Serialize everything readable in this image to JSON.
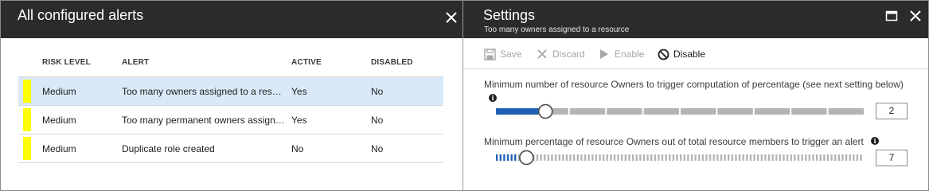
{
  "left_blade": {
    "title": "All configured alerts",
    "columns": [
      "RISK LEVEL",
      "ALERT",
      "ACTIVE",
      "DISABLED"
    ],
    "rows": [
      {
        "risk": "Medium",
        "alert": "Too many owners assigned to a resource",
        "active": "Yes",
        "disabled": "No",
        "selected": true
      },
      {
        "risk": "Medium",
        "alert": "Too many permanent owners assigned",
        "active": "Yes",
        "disabled": "No",
        "selected": false
      },
      {
        "risk": "Medium",
        "alert": "Duplicate role created",
        "active": "No",
        "disabled": "No",
        "selected": false
      }
    ],
    "severity_color": "#ffff00"
  },
  "right_blade": {
    "title": "Settings",
    "subtitle": "Too many owners assigned to a resource",
    "commands": {
      "save": "Save",
      "discard": "Discard",
      "enable": "Enable",
      "disable": "Disable"
    },
    "setting1": {
      "label": "Minimum number of resource Owners to trigger computation of percentage (see next setting below)",
      "value": "2",
      "slider_fraction": 0.1
    },
    "setting2": {
      "label": "Minimum percentage of resource Owners out of total resource members to trigger an alert",
      "value": "7",
      "slider_fraction": 0.07
    }
  },
  "colors": {
    "header_bg": "#2b2b2b",
    "accent": "#1e5fb4",
    "selected_row": "#d9e9f8",
    "track": "#b4b4b4"
  },
  "icons": [
    "close-icon",
    "maximize-icon",
    "save-icon",
    "discard-icon",
    "enable-icon",
    "disable-icon",
    "info-icon"
  ]
}
